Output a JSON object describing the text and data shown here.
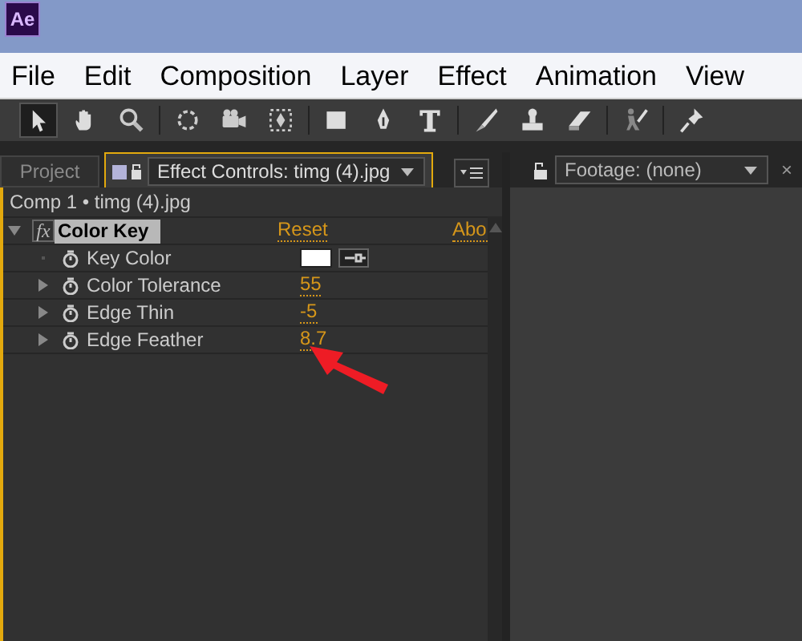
{
  "app_logo": "Ae",
  "menu": [
    "File",
    "Edit",
    "Composition",
    "Layer",
    "Effect",
    "Animation",
    "View"
  ],
  "tools": [
    {
      "kind": "arrow",
      "selected": true
    },
    {
      "kind": "hand",
      "selected": false
    },
    {
      "kind": "zoom",
      "selected": false
    },
    {
      "kind": "rotate",
      "selected": false
    },
    {
      "kind": "camera",
      "selected": false
    },
    {
      "kind": "pan",
      "selected": false
    },
    {
      "kind": "rect",
      "selected": false
    },
    {
      "kind": "pen",
      "selected": false
    },
    {
      "kind": "type",
      "selected": false
    },
    {
      "kind": "brush",
      "selected": false
    },
    {
      "kind": "stamp",
      "selected": false
    },
    {
      "kind": "eraser",
      "selected": false
    },
    {
      "kind": "roto",
      "selected": false
    },
    {
      "kind": "pin",
      "selected": false
    }
  ],
  "left_panel": {
    "tabs": [
      {
        "label": "Project",
        "selected": false
      },
      {
        "label": "Effect Controls: timg (4).jpg",
        "selected": true
      }
    ],
    "breadcrumb": "Comp 1 • timg (4).jpg",
    "effect": {
      "icon": "fx",
      "name": "Color Key",
      "expanded": true,
      "reset": "Reset",
      "about": "Abo",
      "properties": [
        {
          "kind": "color",
          "name": "Key Color",
          "expandable": false,
          "color": "#ffffff"
        },
        {
          "kind": "value",
          "name": "Color Tolerance",
          "expandable": true,
          "value": "55"
        },
        {
          "kind": "value",
          "name": "Edge Thin",
          "expandable": true,
          "value": "-5"
        },
        {
          "kind": "value",
          "name": "Edge Feather",
          "expandable": true,
          "value": "8.7"
        }
      ]
    }
  },
  "right_panel": {
    "tab": {
      "label": "Footage: (none)",
      "close": "×"
    }
  }
}
